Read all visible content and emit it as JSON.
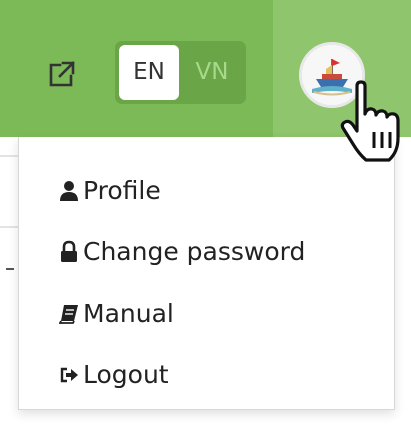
{
  "header": {
    "external_link_icon": "external-link-icon",
    "language": {
      "options": [
        "EN",
        "VN"
      ],
      "selected": "EN"
    },
    "avatar_icon": "boat-avatar"
  },
  "colors": {
    "header_bg": "#7cba57",
    "avatar_zone_bg": "#8fc56d",
    "toggle_bg": "#6aa547",
    "inactive_lang": "#a6d98a"
  },
  "menu": {
    "items": [
      {
        "label": "Profile",
        "icon": "user-icon"
      },
      {
        "label": "Change password",
        "icon": "lock-icon"
      },
      {
        "label": "Manual",
        "icon": "book-icon"
      },
      {
        "label": "Logout",
        "icon": "sign-out-icon"
      }
    ]
  }
}
